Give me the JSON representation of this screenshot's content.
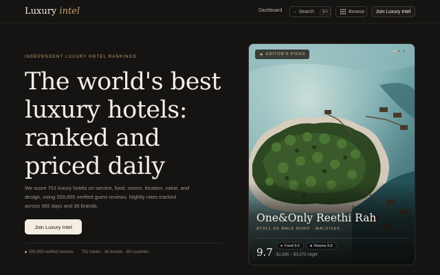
{
  "header": {
    "logo_main": "Luxury",
    "logo_accent": "intel",
    "nav_dashboard": "Dashboard",
    "search_label": "Search",
    "search_shortcut": "⌘K",
    "browse_label": "Browse",
    "join_label": "Join Luxury Intel"
  },
  "hero": {
    "eyebrow": "INDEPENDENT LUXURY HOTEL RANKINGS",
    "headline_lines": [
      "The world's best",
      "luxury hotels:",
      "ranked and",
      "priced daily"
    ],
    "description": "We score 751 luxury hotels on service, food, rooms, location, value, and design, using 359,855 verified guest reviews. Nightly rates tracked across 365 days and 36 brands.",
    "cta_label": "Join Luxury Intel",
    "stats": {
      "reviews": "359,855 verified reviews",
      "counts": "751 hotels · 36 brands · 65 countries"
    }
  },
  "card": {
    "badge": "EDITOR'S PICKS",
    "hotel_name": "One&Only Reethi Rah",
    "location": "ATOLL DE MALE NORD · MALDIVES",
    "score": "9.7",
    "food_label": "Food 9.9",
    "rooms_label": "Rooms 9.9",
    "price": "$1,695 – $3,570 /night",
    "slides_active": 0,
    "colors": {
      "food_dot": "#e0683f",
      "rooms_dot": "#b58cf0",
      "accent": "#c9a36b"
    }
  }
}
